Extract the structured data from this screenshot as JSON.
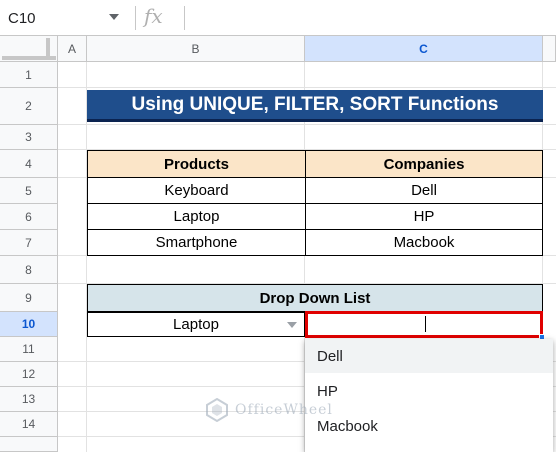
{
  "formula_bar": {
    "cell_reference": "C10",
    "fx_icon": "function-icon",
    "formula": ""
  },
  "columns": [
    "A",
    "B",
    "C"
  ],
  "selected_column": "C",
  "rows": [
    "1",
    "2",
    "3",
    "4",
    "5",
    "6",
    "7",
    "8",
    "9",
    "10",
    "11",
    "12",
    "13",
    "14"
  ],
  "selected_row": "10",
  "sheet": {
    "title": "Using UNIQUE, FILTER, SORT Functions",
    "table": {
      "headers": [
        "Products",
        "Companies"
      ],
      "rows": [
        [
          "Keyboard",
          "Dell"
        ],
        [
          "Laptop",
          "HP"
        ],
        [
          "Smartphone",
          "Macbook"
        ]
      ]
    },
    "dropdown_header": "Drop Down List",
    "dropdown_value": "Laptop",
    "active_cell_value": ""
  },
  "dropdown_menu": {
    "options": [
      "Dell",
      "HP",
      "Macbook"
    ],
    "hovered_index": 0
  },
  "watermark": {
    "text": "OfficeWheel",
    "icon": "officewheel-logo-icon"
  },
  "colors": {
    "title_bg": "#1f4e8c",
    "table_header_bg": "#fbe5c8",
    "dropdown_header_bg": "#d6e4ea",
    "active_cell_border": "#e00000",
    "selection_header_bg": "#d3e3fd"
  }
}
